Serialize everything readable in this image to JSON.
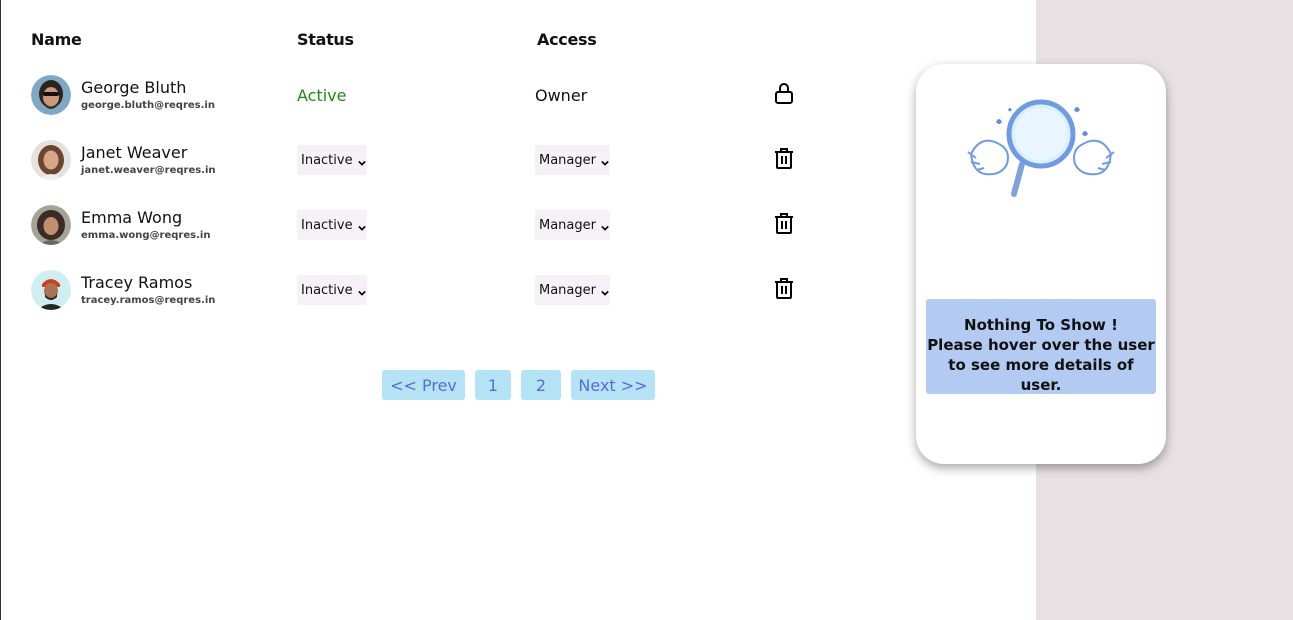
{
  "table": {
    "headers": {
      "name": "Name",
      "status": "Status",
      "access": "Access"
    },
    "rows": [
      {
        "name": "George Bluth",
        "email": "george.bluth@reqres.in",
        "status": "Active",
        "access": "Owner",
        "action_icon": "lock-icon"
      },
      {
        "name": "Janet Weaver",
        "email": "janet.weaver@reqres.in",
        "status": "Inactive",
        "access": "Manager",
        "action_icon": "trash-icon"
      },
      {
        "name": "Emma Wong",
        "email": "emma.wong@reqres.in",
        "status": "Inactive",
        "access": "Manager",
        "action_icon": "trash-icon"
      },
      {
        "name": "Tracey Ramos",
        "email": "tracey.ramos@reqres.in",
        "status": "Inactive",
        "access": "Manager",
        "action_icon": "trash-icon"
      }
    ]
  },
  "pagination": {
    "prev": "<< Prev",
    "page1": "1",
    "page2": "2",
    "next": "Next >>"
  },
  "detail_panel": {
    "title": "Nothing To Show !",
    "line2": "Please hover over the user",
    "line3": "to see more details of user."
  },
  "colors": {
    "active": "#1a8a1a",
    "pagination_bg": "#b3e3f4",
    "pagination_text": "#5a6ad6",
    "message_bg": "#b3caf2",
    "sidebar_bg": "#e8e0e2"
  }
}
